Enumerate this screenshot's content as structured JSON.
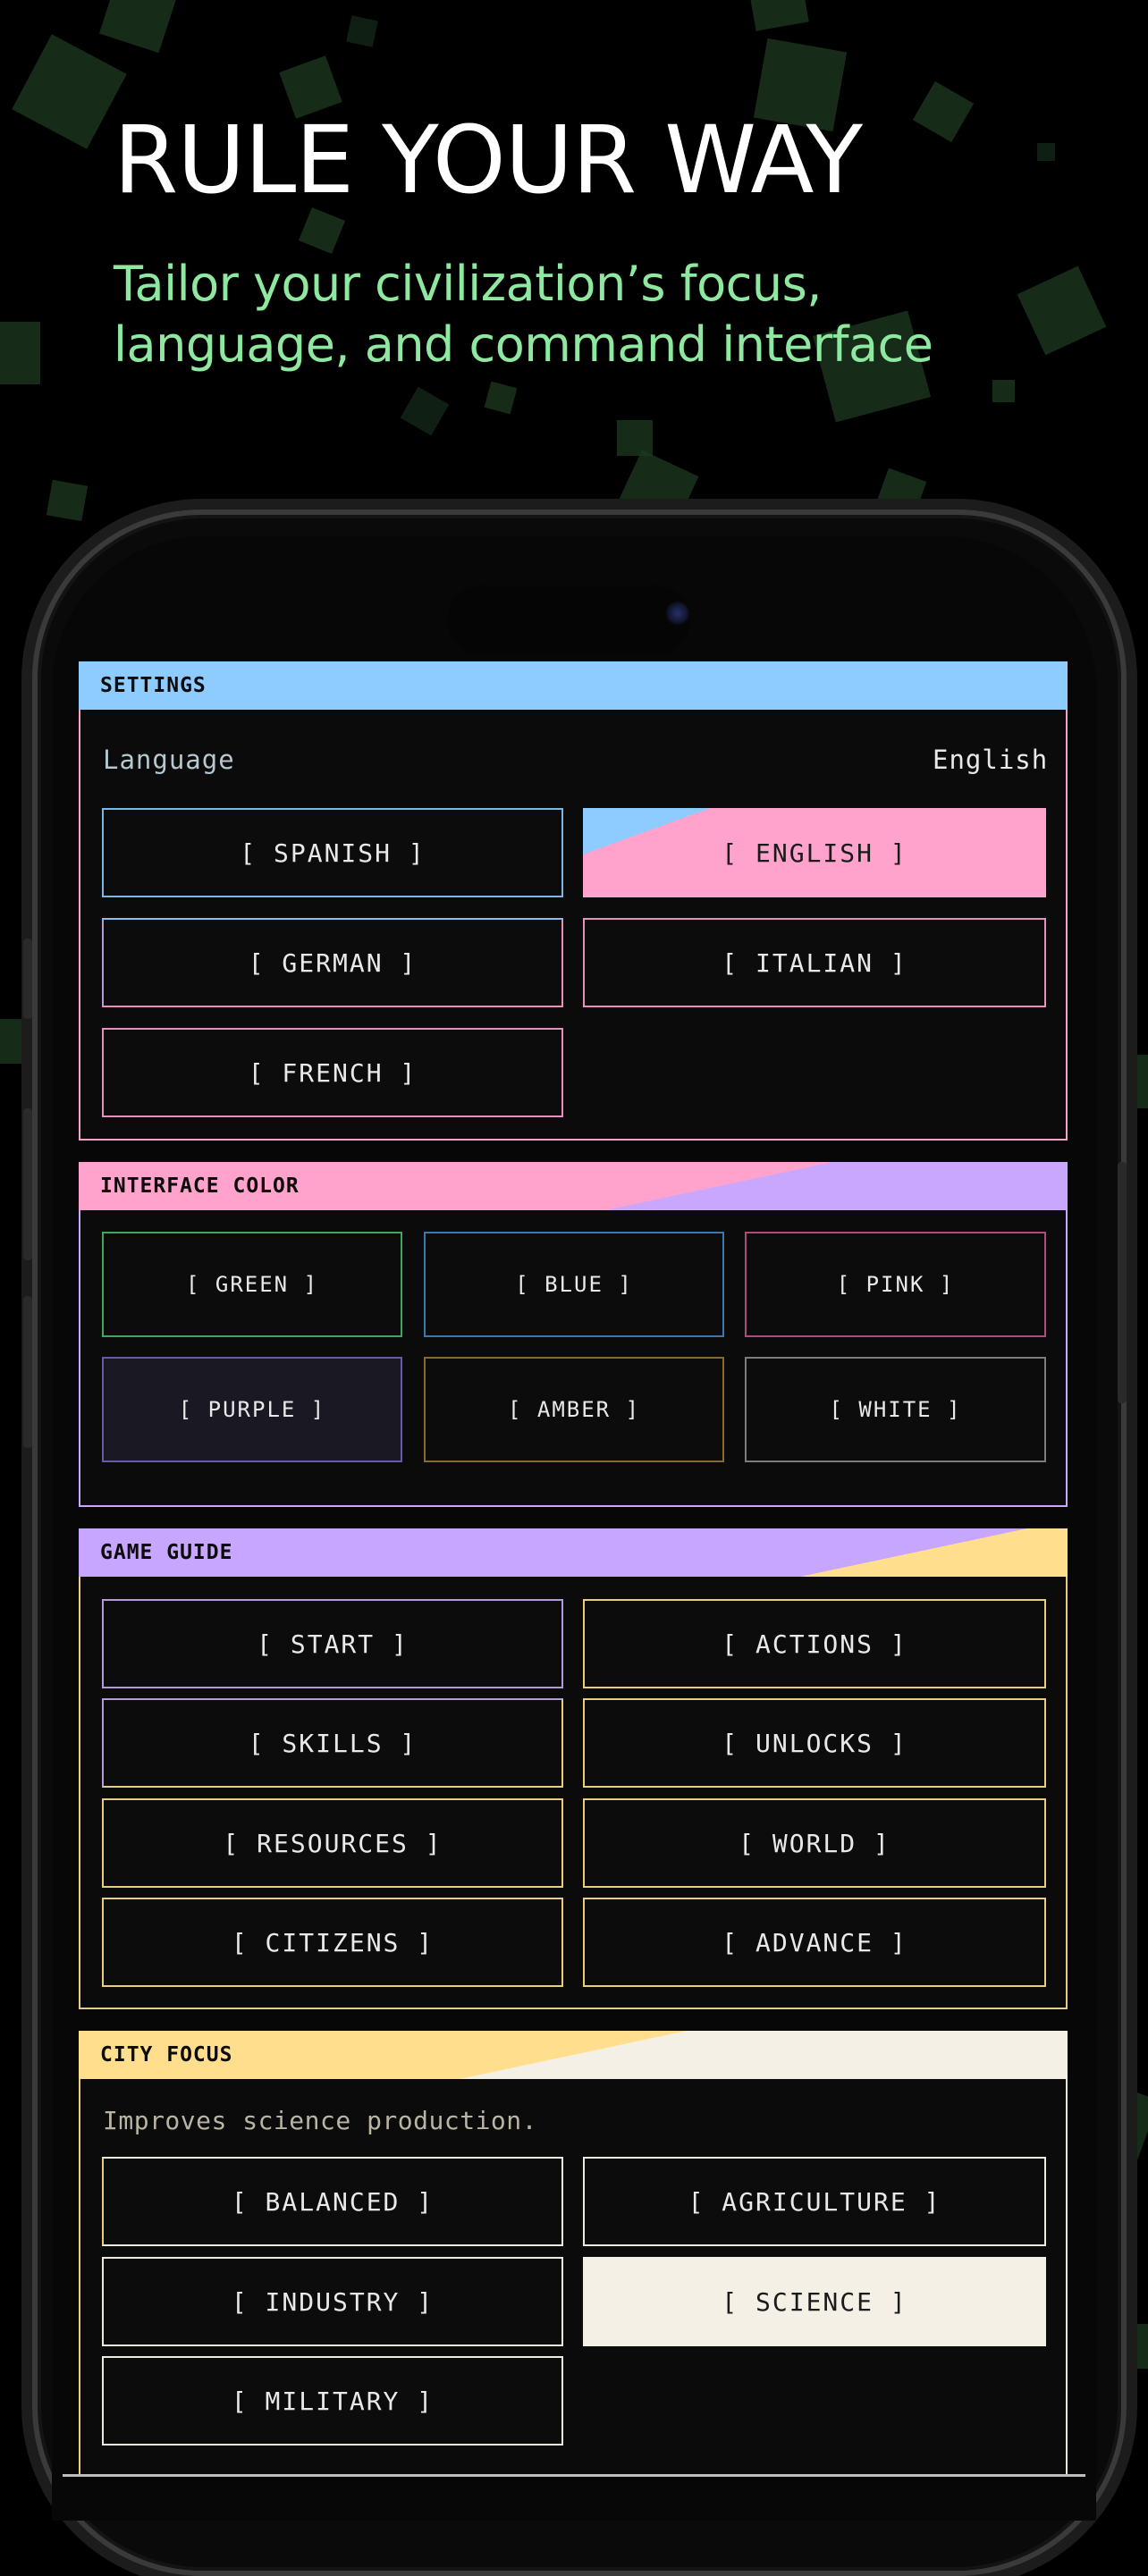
{
  "promo": {
    "headline": "RULE YOUR WAY",
    "subhead": "Tailor your civilization’s focus, language, and command interface",
    "accent_color": "#8ee8a0"
  },
  "settings": {
    "title": "SETTINGS",
    "language_label": "Language",
    "language_value": "English",
    "header_color": "#8ecbff",
    "languages": [
      {
        "label": "[ SPANISH ]",
        "selected": false
      },
      {
        "label": "[ ENGLISH ]",
        "selected": true
      },
      {
        "label": "[ GERMAN ]",
        "selected": false
      },
      {
        "label": "[ ITALIAN ]",
        "selected": false
      },
      {
        "label": "[ FRENCH ]",
        "selected": false
      }
    ]
  },
  "interface_color": {
    "title": "INTERFACE COLOR",
    "header_color": "#ff9fcd",
    "options": [
      {
        "label": "[ GREEN ]",
        "color": "#3fa65a",
        "selected": false
      },
      {
        "label": "[ BLUE ]",
        "color": "#3c78b0",
        "selected": false
      },
      {
        "label": "[ PINK ]",
        "color": "#b04a7a",
        "selected": false
      },
      {
        "label": "[ PURPLE ]",
        "color": "#6a58a8",
        "selected": true
      },
      {
        "label": "[ AMBER ]",
        "color": "#8a6a2a",
        "selected": false
      },
      {
        "label": "[ WHITE ]",
        "color": "#7c7c7c",
        "selected": false
      }
    ]
  },
  "game_guide": {
    "title": "GAME GUIDE",
    "header_color": "#c7a6ff",
    "items": [
      "[ START ]",
      "[ ACTIONS ]",
      "[ SKILLS ]",
      "[ UNLOCKS ]",
      "[ RESOURCES ]",
      "[ WORLD ]",
      "[ CITIZENS ]",
      "[ ADVANCE ]"
    ]
  },
  "city_focus": {
    "title": "CITY FOCUS",
    "description": "Improves science production.",
    "header_color": "#ffdf8e",
    "options": [
      {
        "label": "[ BALANCED ]",
        "selected": false
      },
      {
        "label": "[ AGRICULTURE ]",
        "selected": false
      },
      {
        "label": "[ INDUSTRY ]",
        "selected": false
      },
      {
        "label": "[ SCIENCE ]",
        "selected": true
      },
      {
        "label": "[ MILITARY ]",
        "selected": false
      }
    ]
  }
}
